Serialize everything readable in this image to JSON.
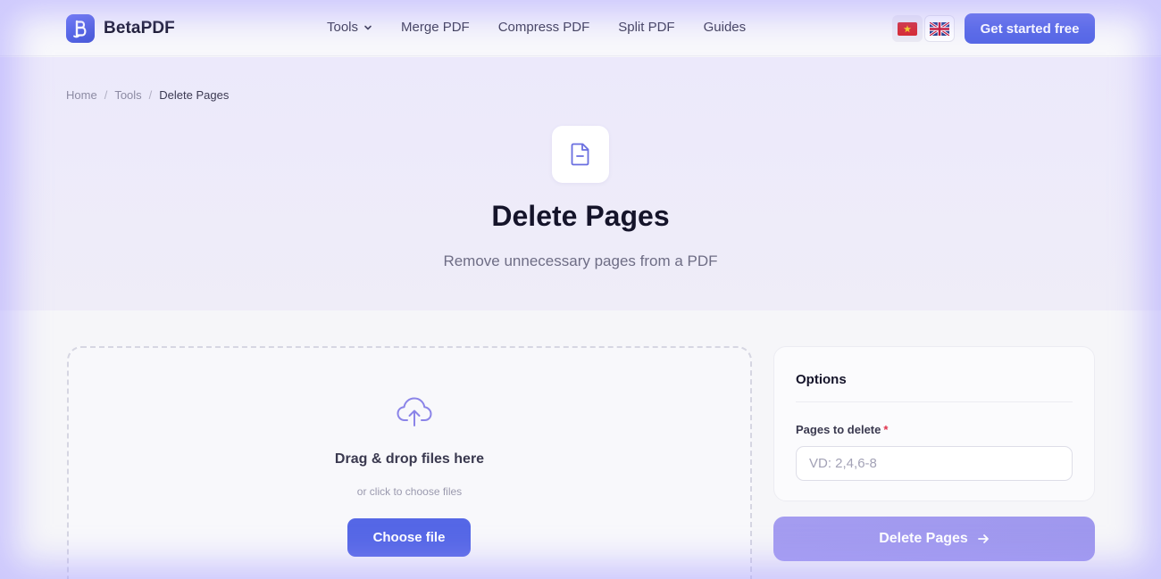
{
  "header": {
    "brand": "BetaPDF",
    "nav": [
      {
        "label": "Tools",
        "has_dropdown": true
      },
      {
        "label": "Merge PDF"
      },
      {
        "label": "Compress PDF"
      },
      {
        "label": "Split PDF"
      },
      {
        "label": "Guides"
      }
    ],
    "languages": [
      {
        "name": "vietnamese-flag-icon",
        "active": false
      },
      {
        "name": "uk-flag-icon",
        "active": true
      }
    ],
    "cta_label": "Get started free"
  },
  "breadcrumb": {
    "items": [
      "Home",
      "Tools"
    ],
    "current": "Delete Pages",
    "separator": "/"
  },
  "hero": {
    "icon": "file-minus-icon",
    "title": "Delete Pages",
    "subtitle": "Remove unnecessary pages from a PDF"
  },
  "upload": {
    "icon": "upload-cloud-icon",
    "title": "Drag & drop files here",
    "subtitle": "or click to choose files",
    "button_label": "Choose file"
  },
  "options": {
    "title": "Options",
    "pages_label": "Pages to delete",
    "required_mark": "*",
    "pages_placeholder": "VD: 2,4,6-8",
    "pages_value": ""
  },
  "submit": {
    "label": "Delete Pages",
    "icon": "arrow-right-icon"
  },
  "colors": {
    "primary": "#5567e6",
    "primary_disabled": "#a49cf0",
    "hero_bg": "#ece9fb",
    "required": "#e0334d"
  }
}
